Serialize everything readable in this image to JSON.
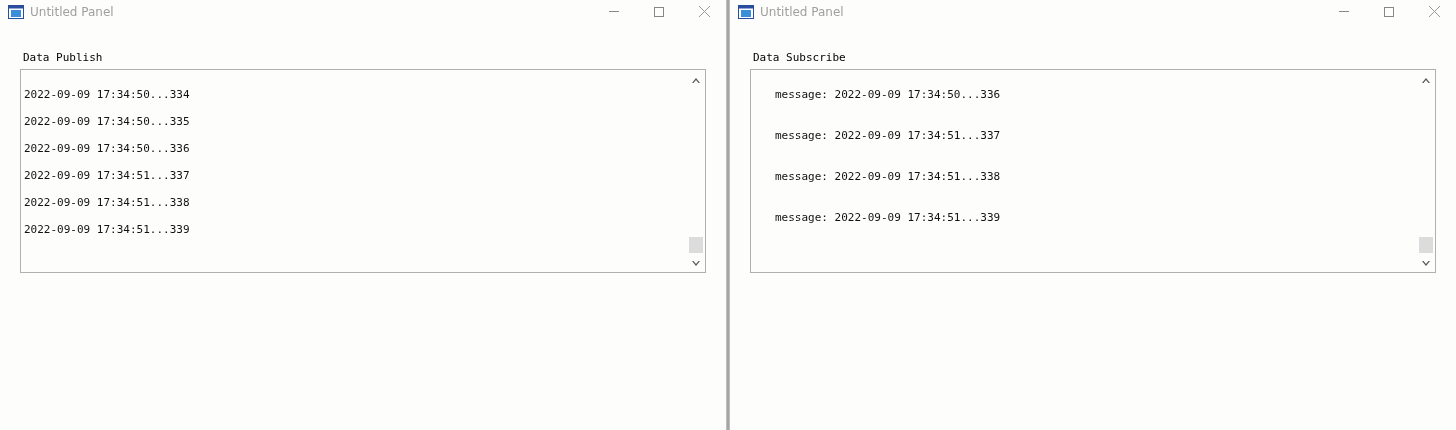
{
  "windows": [
    {
      "title": "Untitled Panel",
      "label": "Data Publish",
      "kind": "publish",
      "lines": [
        "2022-09-09 17:34:50...334",
        "2022-09-09 17:34:50...335",
        "2022-09-09 17:34:50...336",
        "2022-09-09 17:34:51...337",
        "2022-09-09 17:34:51...338",
        "2022-09-09 17:34:51...339"
      ]
    },
    {
      "title": "Untitled Panel",
      "label": "Data Subscribe",
      "kind": "subscribe",
      "lines": [
        "message: 2022-09-09 17:34:50...336",
        "message: 2022-09-09 17:34:51...337",
        "message: 2022-09-09 17:34:51...338",
        "message: 2022-09-09 17:34:51...339"
      ]
    }
  ]
}
